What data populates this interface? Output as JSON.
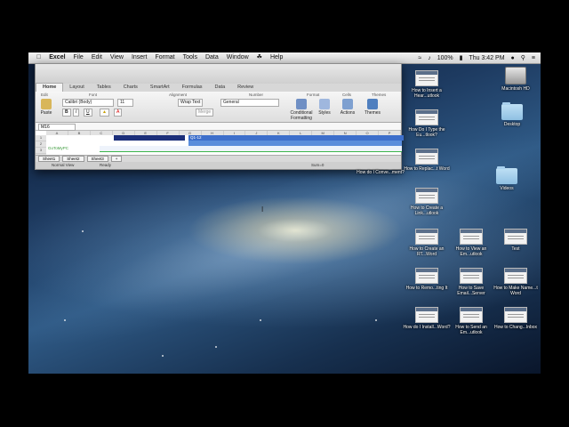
{
  "menubar": {
    "app": "Excel",
    "items": [
      "File",
      "Edit",
      "View",
      "Insert",
      "Format",
      "Tools",
      "Data",
      "Window",
      "☘",
      "Help"
    ],
    "battery": "100%",
    "clock": "Thu 3:42 PM"
  },
  "excel": {
    "ribbon_tabs": [
      "Home",
      "Layout",
      "Tables",
      "Charts",
      "SmartArt",
      "Formulas",
      "Data",
      "Review"
    ],
    "groups": [
      "Edit",
      "Font",
      "Alignment",
      "Number",
      "Format",
      "Cells",
      "Themes"
    ],
    "paste": "Paste",
    "font_name": "Calibri (Body)",
    "font_size": "11",
    "wrap_text": "Wrap Text",
    "merge": "Merge",
    "number_format": "General",
    "conditional_formatting": "Conditional Formatting",
    "styles": "Styles",
    "actions": "Actions",
    "themes": "Themes",
    "cell_ref": "M16",
    "columns": [
      "A",
      "B",
      "C",
      "D",
      "E",
      "F",
      "G",
      "H",
      "I",
      "J",
      "K",
      "L",
      "M",
      "N",
      "O",
      "P"
    ],
    "rows": [
      "1",
      "2",
      "3",
      "4"
    ],
    "quarter_label": "Q1-12",
    "gotomypc": "GoToMyPC",
    "sheets": [
      "Sheet1",
      "Sheet2",
      "Sheet3",
      "+"
    ],
    "status_view": "Normal View",
    "status_ready": "Ready",
    "status_sum": "Sum=0"
  },
  "desktop_icons": [
    {
      "label": "Macintosh HD",
      "type": "hdd"
    },
    {
      "label": "Desktop",
      "type": "folder"
    },
    {
      "label": "Videos",
      "type": "folder"
    },
    {
      "label": "How to Insert a Hear...utlook",
      "type": "doc"
    },
    {
      "label": "How Do I Type the Eu...tlook?",
      "type": "doc"
    },
    {
      "label": "How to Replac...t Word",
      "type": "doc"
    },
    {
      "label": "How to Create a Link...utlook",
      "type": "doc"
    },
    {
      "label": "How do I Conve...ment?",
      "type": "doc"
    },
    {
      "label": "How to Create an RT...Word",
      "type": "doc"
    },
    {
      "label": "How to View an Em...utlook",
      "type": "doc"
    },
    {
      "label": "Test",
      "type": "doc"
    },
    {
      "label": "How to Remo...ting It",
      "type": "doc"
    },
    {
      "label": "How to Save Email...Server",
      "type": "doc"
    },
    {
      "label": "How to Make Name...t Word",
      "type": "doc"
    },
    {
      "label": "How do I Install...Word?",
      "type": "doc"
    },
    {
      "label": "How to Send an Em...utlook",
      "type": "doc"
    },
    {
      "label": "How to Chang...Inbox",
      "type": "doc"
    }
  ]
}
